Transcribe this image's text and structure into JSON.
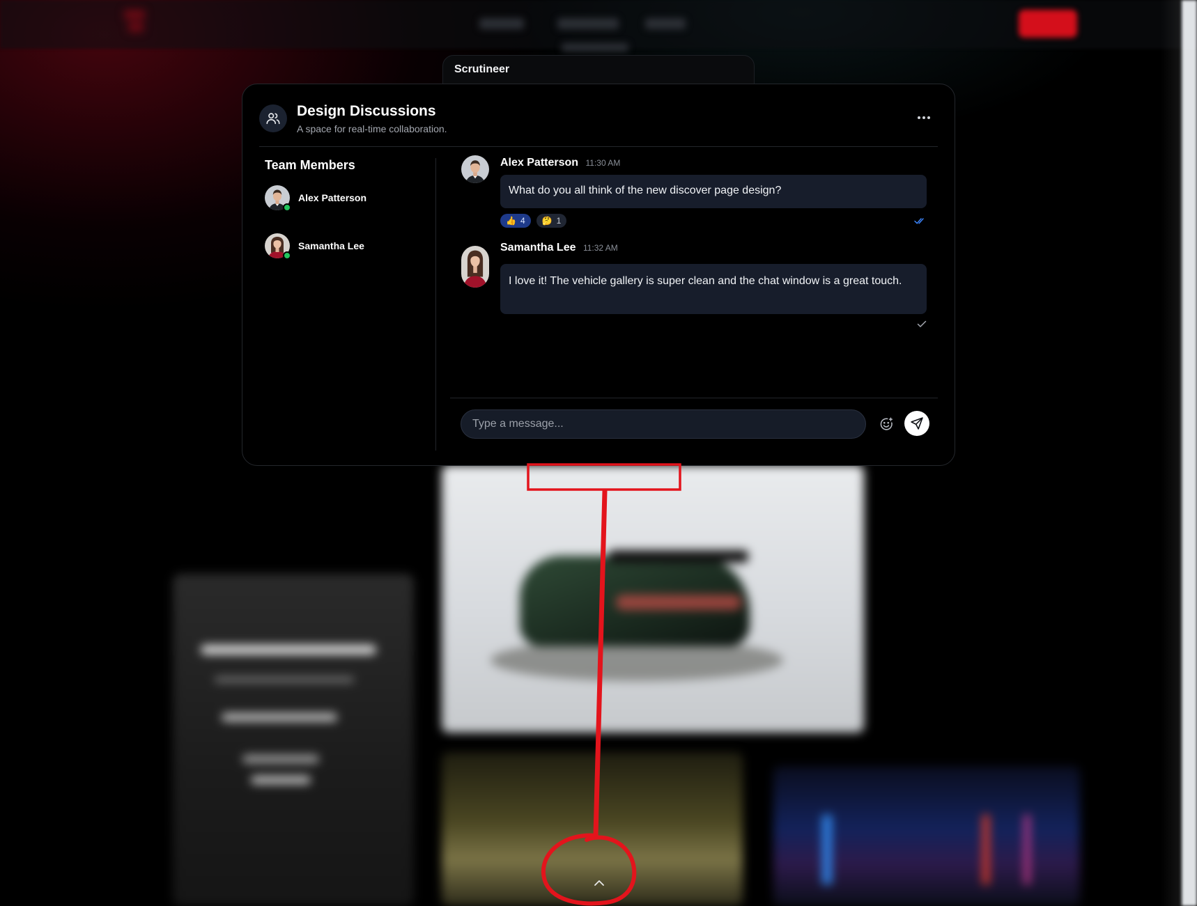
{
  "tab": {
    "label": "Scrutineer"
  },
  "chat_window": {
    "title": "Design Discussions",
    "subtitle": "A space for real-time collaboration.",
    "header_icon": "users-icon",
    "more_icon": "more-horizontal-icon"
  },
  "members": {
    "heading": "Team Members",
    "items": [
      {
        "name": "Alex Patterson",
        "status": "online"
      },
      {
        "name": "Samantha Lee",
        "status": "online"
      }
    ]
  },
  "messages": [
    {
      "author": "Alex Patterson",
      "time": "11:30 AM",
      "text": "What do you all think of the new discover page design?",
      "reactions": [
        {
          "emoji": "👍",
          "count": "4"
        },
        {
          "emoji": "🤔",
          "count": "1"
        }
      ],
      "status": "read"
    },
    {
      "author": "Samantha Lee",
      "time": "11:32 AM",
      "text": "I love it! The vehicle gallery is super clean and the chat window is a great touch.",
      "reactions": [],
      "status": "sent"
    }
  ],
  "composer": {
    "placeholder": "Type a message...",
    "emoji_icon": "smile-icon",
    "send_icon": "send-icon"
  },
  "colors": {
    "online": "#22c55e",
    "bubble": "#171d2b",
    "annotation": "#e3141c",
    "read_tick": "#3b82f6"
  }
}
